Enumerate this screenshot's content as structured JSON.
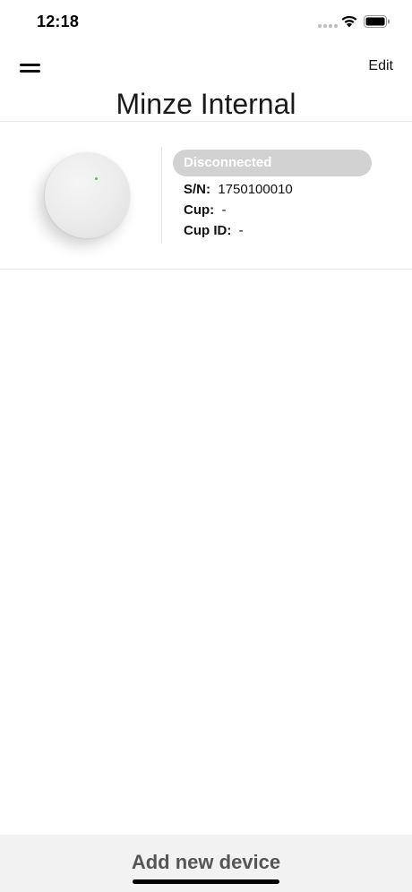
{
  "status_bar": {
    "time": "12:18",
    "icons": [
      "signal-dots-icon",
      "wifi-icon",
      "battery-icon"
    ]
  },
  "nav": {
    "menu_icon": "hamburger-menu-icon",
    "edit_label": "Edit"
  },
  "page": {
    "title": "Minze Internal"
  },
  "device": {
    "status": "Disconnected",
    "sn_label": "S/N:",
    "sn_value": "1750100010",
    "cup_label": "Cup:",
    "cup_value": "-",
    "cup_id_label": "Cup ID:",
    "cup_id_value": "-"
  },
  "footer": {
    "add_device_label": "Add new device"
  },
  "colors": {
    "status_badge": "#d2d2d2",
    "led": "#3fd43f",
    "bottom_bar": "#f2f2f2"
  }
}
